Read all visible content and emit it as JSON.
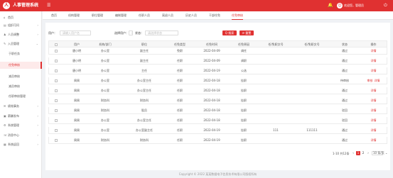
{
  "header": {
    "logo_glyph": "人",
    "title": "人事管理系统",
    "collapse_glyph": "☰",
    "bell_glyph": "🔔",
    "avatar_glyph": "☺",
    "welcome": "欢迎您，管理员",
    "power_glyph": "⏻",
    "accent_color": "#e03131"
  },
  "sidebar": {
    "items": [
      {
        "icon": "⌂",
        "label": "首页",
        "chevron": ""
      },
      {
        "icon": "▤",
        "label": "组织可问",
        "chevron": "›"
      },
      {
        "icon": "♟",
        "label": "人员调整",
        "chevron": "›"
      },
      {
        "icon": "✎",
        "label": "入员管理",
        "chevron": "⌄"
      },
      {
        "icon": "",
        "label": "于职任务",
        "chevron": ""
      },
      {
        "icon": "",
        "label": "任免审核",
        "chevron": ""
      },
      {
        "icon": "",
        "label": "减员审核",
        "chevron": ""
      },
      {
        "icon": "",
        "label": "减员审核",
        "chevron": ""
      },
      {
        "icon": "",
        "label": "任职审核管理",
        "chevron": ""
      },
      {
        "icon": "✉",
        "label": "绩效事务",
        "chevron": "›"
      },
      {
        "icon": "▣",
        "label": "薪酬发布",
        "chevron": "›"
      },
      {
        "icon": "⚙",
        "label": "系统管理",
        "chevron": "›"
      },
      {
        "icon": "☏",
        "label": "消息中心",
        "chevron": "›"
      },
      {
        "icon": "▦",
        "label": "系统返回",
        "chevron": "›"
      }
    ]
  },
  "tabs": [
    "首页",
    "机构管理",
    "职位管理",
    "编制管理",
    "任职人员",
    "离退人员",
    "历史人员",
    "干部任免",
    "任免审核"
  ],
  "filters": {
    "name_label": "用户：",
    "name_placeholder": "请输入用户名",
    "selected_label": "选择用户：",
    "selected_placeholder": "请选择",
    "status_label": "状态：",
    "status_placeholder": "请选择状态",
    "search_label": "Q 搜索",
    "reset_label": "⟳ 重置"
  },
  "table": {
    "columns": [
      "",
      "用户",
      "机构/部门",
      "职位",
      "任免类型",
      "任免时间",
      "任免原因",
      "任/免职文号",
      "任/免职文号",
      "状态",
      "操作"
    ],
    "rows": [
      [
        "",
        "唐小明",
        "办公室",
        "副主任",
        "免职",
        "2022-04-09",
        "调任",
        "",
        "",
        "通过",
        [
          "详情"
        ]
      ],
      [
        "",
        "唐小明",
        "办公室",
        "副主任",
        "任职",
        "2022-04-09",
        "调职",
        "",
        "",
        "通过",
        [
          "详情"
        ]
      ],
      [
        "",
        "唐小明",
        "办公室",
        "主任",
        "任职",
        "2022-04-19",
        "公选",
        "",
        "",
        "通过",
        [
          "详情"
        ]
      ],
      [
        "",
        "周周",
        "办公室",
        "办公室主任",
        "任职",
        "2022-04-18",
        "挂职",
        "",
        "",
        "待审核",
        [
          "审核",
          "详情"
        ]
      ],
      [
        "",
        "周周",
        "办公室",
        "办公室主任",
        "任职",
        "2022-04-18",
        "挂职",
        "",
        "",
        "通过",
        [
          "详情"
        ]
      ],
      [
        "",
        "周周",
        "财务科",
        "财务科",
        "任职",
        "2022-04-18",
        "挂职",
        "",
        "",
        "通过",
        [
          "详情"
        ]
      ],
      [
        "",
        "周周",
        "财务科",
        "股员",
        "任职",
        "2022-04-18",
        "挂职",
        "",
        "",
        "驳回",
        [
          "详情"
        ]
      ],
      [
        "",
        "周周",
        "办公室",
        "办公室主任",
        "任职",
        "2022-04-18",
        "挂职",
        "",
        "",
        "驳回",
        [
          "详情"
        ]
      ],
      [
        "",
        "周周",
        "办公室",
        "办公室副主任",
        "任职",
        "2022-04-19",
        "挂职",
        "111",
        "111111",
        "通过",
        [
          "详情"
        ]
      ],
      [
        "",
        "周周",
        "财务科",
        "财务科",
        "任职",
        "2022-04-19",
        "挂职",
        "",
        "",
        "通过",
        [
          "详情"
        ]
      ]
    ]
  },
  "pagination": {
    "total": "1-10 共12条",
    "prev": "‹",
    "pages": [
      "1",
      "2"
    ],
    "current": "1",
    "next": "›",
    "page_size": "10 条/页 ⌄"
  },
  "footer": "Copyright © 2022 某某数据电子信息技术有限公司版权所有"
}
